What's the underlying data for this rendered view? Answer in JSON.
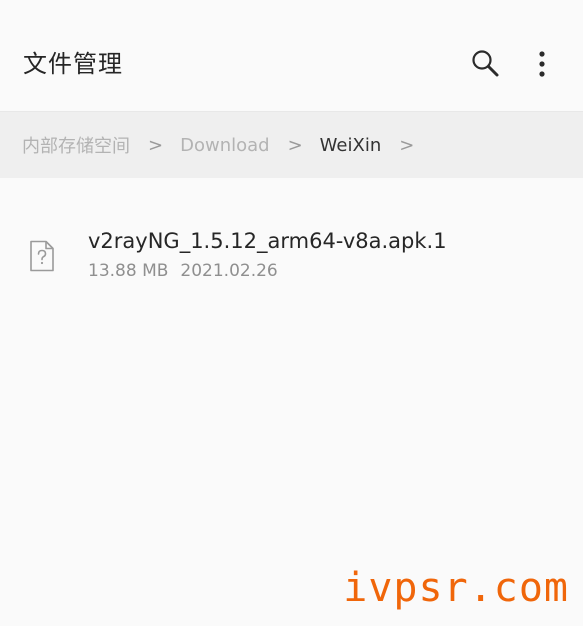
{
  "header": {
    "title": "文件管理",
    "search_icon": "search-icon",
    "more_icon": "more-vertical-icon"
  },
  "breadcrumb": {
    "items": [
      {
        "label": "内部存储空间"
      },
      {
        "label": "Download"
      },
      {
        "label": "WeiXin"
      }
    ],
    "separator": ">"
  },
  "files": [
    {
      "name": "v2rayNG_1.5.12_arm64-v8a.apk.1",
      "size": "13.88 MB",
      "date": "2021.02.26",
      "icon": "unknown-file-icon"
    }
  ],
  "watermark": "ivpsr.com",
  "colors": {
    "background": "#fafafa",
    "breadcrumb_bg": "#efefef",
    "watermark": "#f0660a"
  }
}
